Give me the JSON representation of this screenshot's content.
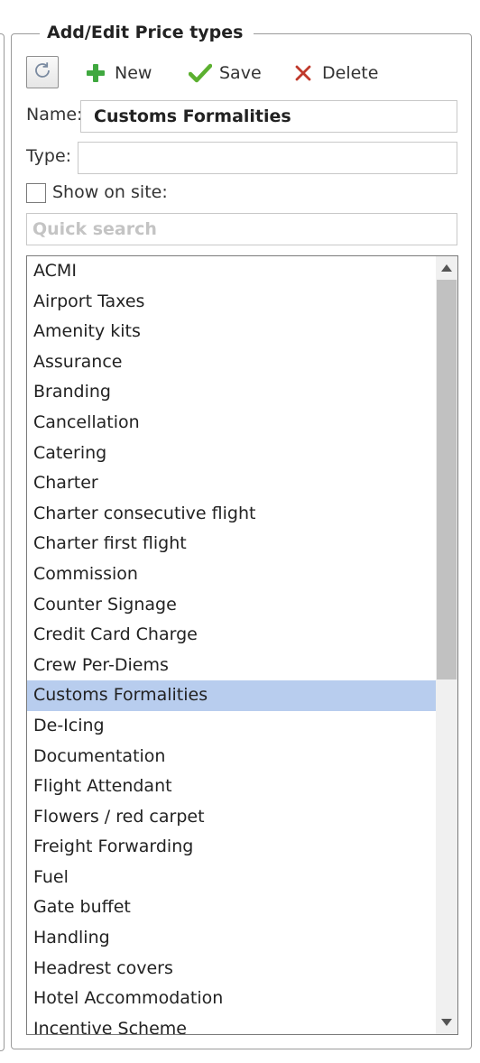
{
  "panel": {
    "title": "Add/Edit Price types"
  },
  "toolbar": {
    "new_label": "New",
    "save_label": "Save",
    "delete_label": "Delete"
  },
  "form": {
    "name_label": "Name:",
    "name_value": "Customs Formalities",
    "type_label": "Type:",
    "type_value": "",
    "show_on_site_label": "Show on site:",
    "show_on_site_checked": false
  },
  "search": {
    "placeholder": "Quick search",
    "value": ""
  },
  "price_types": [
    "ACMI",
    "Airport Taxes",
    "Amenity kits",
    "Assurance",
    "Branding",
    "Cancellation",
    "Catering",
    "Charter",
    "Charter consecutive flight",
    "Charter first flight",
    "Commission",
    "Counter Signage",
    "Credit Card Charge",
    "Crew Per-Diems",
    "Customs Formalities",
    "De-Icing",
    "Documentation",
    "Flight Attendant",
    "Flowers / red carpet",
    "Freight Forwarding",
    "Fuel",
    "Gate buffet",
    "Handling",
    "Headrest covers",
    "Hotel Accommodation",
    "Incentive Scheme"
  ],
  "selected_item": "Customs Formalities",
  "colors": {
    "selection": "#b8cdee",
    "add_icon": "#3fa83f",
    "save_icon": "#5cb030",
    "delete_icon": "#c0392b"
  }
}
